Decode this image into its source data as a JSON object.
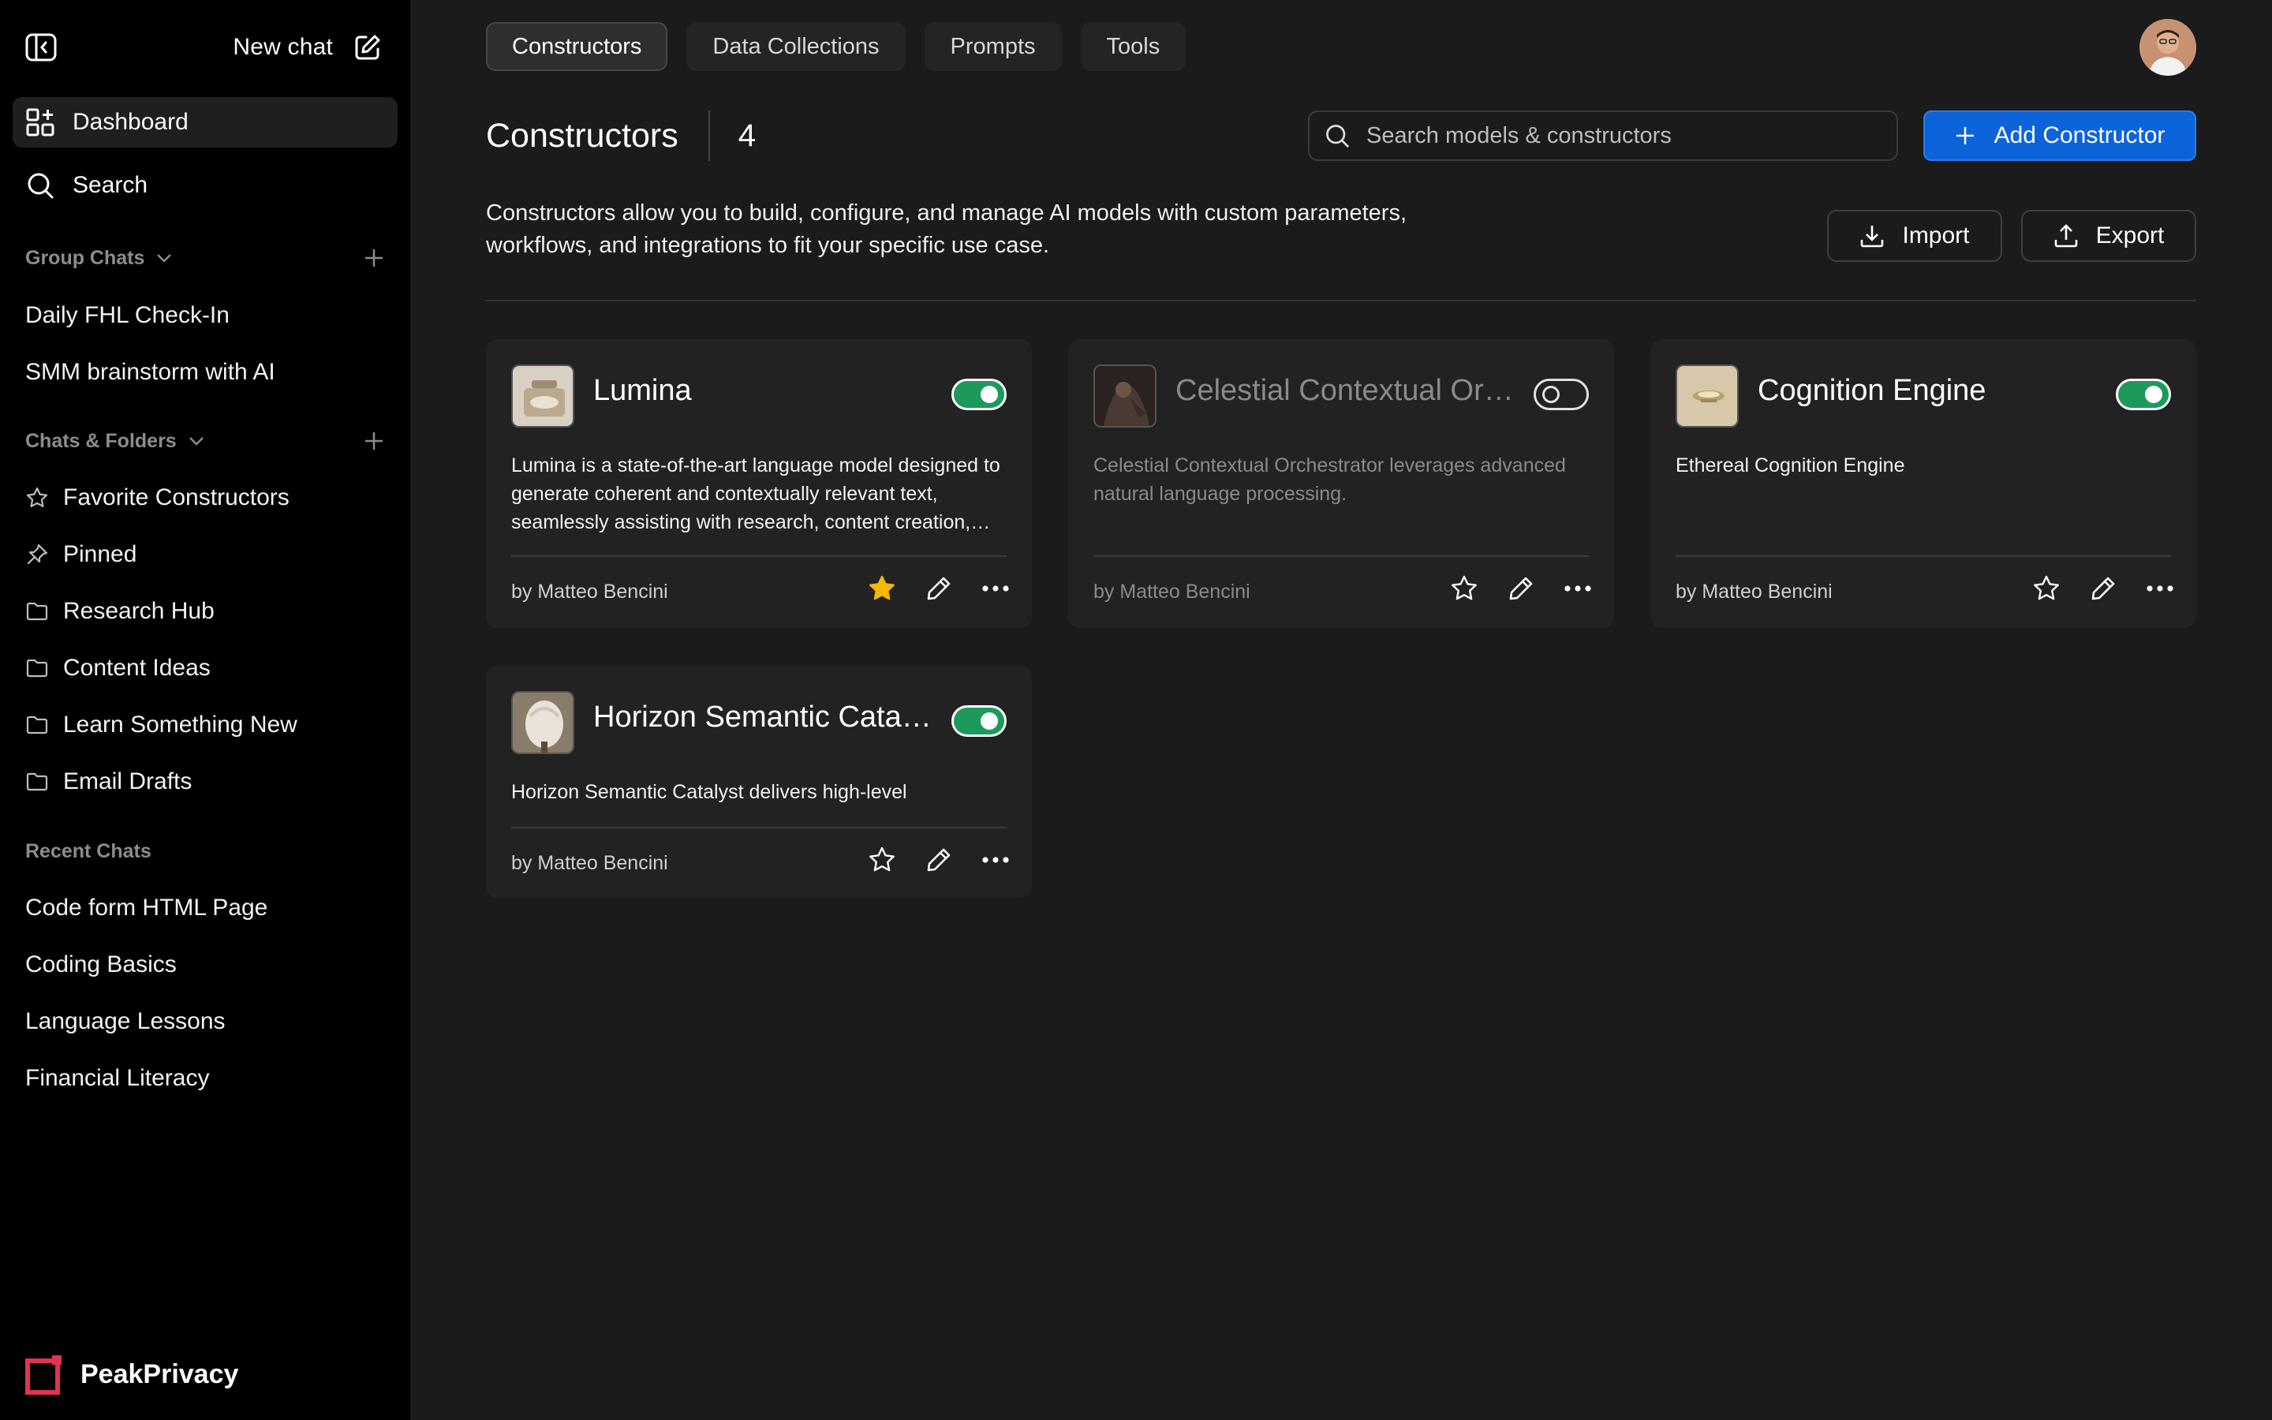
{
  "sidebar": {
    "new_chat_label": "New chat",
    "nav": [
      {
        "label": "Dashboard",
        "icon": "dashboard-icon"
      },
      {
        "label": "Search",
        "icon": "search-icon"
      }
    ],
    "group_chats": {
      "heading": "Group Chats",
      "items": [
        "Daily FHL Check-In",
        "SMM brainstorm with AI"
      ]
    },
    "chats_folders": {
      "heading": "Chats & Folders",
      "items": [
        {
          "label": "Favorite Constructors",
          "icon": "star-icon"
        },
        {
          "label": "Pinned",
          "icon": "pin-icon"
        },
        {
          "label": "Research Hub",
          "icon": "folder-icon"
        },
        {
          "label": "Content Ideas",
          "icon": "folder-icon"
        },
        {
          "label": "Learn Something New",
          "icon": "folder-icon"
        },
        {
          "label": "Email Drafts",
          "icon": "folder-icon"
        }
      ]
    },
    "recent": {
      "heading": "Recent Chats",
      "items": [
        "Code form HTML Page",
        "Coding Basics",
        "Language Lessons",
        "Financial Literacy"
      ]
    },
    "brand": "PeakPrivacy"
  },
  "tabs": [
    "Constructors",
    "Data Collections",
    "Prompts",
    "Tools"
  ],
  "active_tab": "Constructors",
  "header": {
    "title": "Constructors",
    "count": "4",
    "search_placeholder": "Search models & constructors",
    "add_label": "Add Constructor"
  },
  "description": "Constructors allow you to build, configure, and manage AI models with custom parameters, workflows, and integrations to fit your specific use case.",
  "import_label": "Import",
  "export_label": "Export",
  "cards": [
    {
      "name": "Lumina",
      "enabled": true,
      "favorite": true,
      "description": "Lumina is a state-of-the-art language model designed to generate coherent and contextually relevant text, seamlessly assisting with research, content creation, and more.",
      "author": "by Matteo Bencini"
    },
    {
      "name": "Celestial Contextual Orchestrator",
      "enabled": false,
      "favorite": false,
      "description": "Celestial Contextual Orchestrator leverages advanced natural language processing.",
      "author": "by Matteo Bencini"
    },
    {
      "name": "Cognition Engine",
      "enabled": true,
      "favorite": false,
      "description": "Ethereal Cognition Engine",
      "author": "by Matteo Bencini"
    },
    {
      "name": "Horizon Semantic Catalyst",
      "enabled": true,
      "favorite": false,
      "description": "Horizon Semantic Catalyst delivers high-level",
      "author": "by Matteo Bencini"
    }
  ],
  "colors": {
    "accent": "#0d63d9",
    "toggle_on": "#1d9a5b",
    "favorite_star": "#f5b800",
    "brand": "#e0344f"
  }
}
